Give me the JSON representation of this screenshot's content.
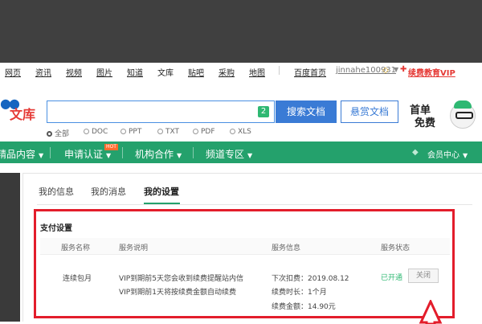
{
  "topnav": {
    "items": [
      "网页",
      "资讯",
      "视频",
      "图片",
      "知道",
      "文库",
      "贴吧",
      "采购",
      "地图"
    ],
    "baidu_home": "百度首页",
    "username": "jinnahe100931",
    "vip_link": "续费教育VIP"
  },
  "logo": {
    "text": "文库"
  },
  "search": {
    "value": "",
    "badge": "2",
    "search_button": "搜索文档",
    "reward_button": "悬赏文档"
  },
  "promo": {
    "line1": "首单",
    "line2": "免费"
  },
  "filetypes": {
    "options": [
      "全部",
      "DOC",
      "PPT",
      "TXT",
      "PDF",
      "XLS"
    ],
    "selected": "全部"
  },
  "mainnav": {
    "items": [
      "精品内容",
      "申请认证",
      "机构合作",
      "频道专区"
    ],
    "hot_badge": "HOT",
    "member_center": "会员中心"
  },
  "tabs": {
    "items": [
      "我的信息",
      "我的消息",
      "我的设置"
    ],
    "active": "我的设置"
  },
  "payment": {
    "title": "支付设置",
    "headers": [
      "服务名称",
      "服务说明",
      "服务信息",
      "服务状态"
    ],
    "row": {
      "name": "连续包月",
      "desc1": "VIP到期前5天您会收到续费提醒站内信",
      "desc2": "VIP到期前1天将按续费金额自动续费",
      "info1": "下次扣费：2019.08.12",
      "info2": "续费时长：1个月",
      "info3": "续费金额：14.90元",
      "status": "已开通",
      "close_button": "关闭"
    }
  },
  "colors": {
    "brand_green": "#24a16c",
    "search_blue": "#3a7bd5",
    "highlight_red": "#e31d2b"
  }
}
